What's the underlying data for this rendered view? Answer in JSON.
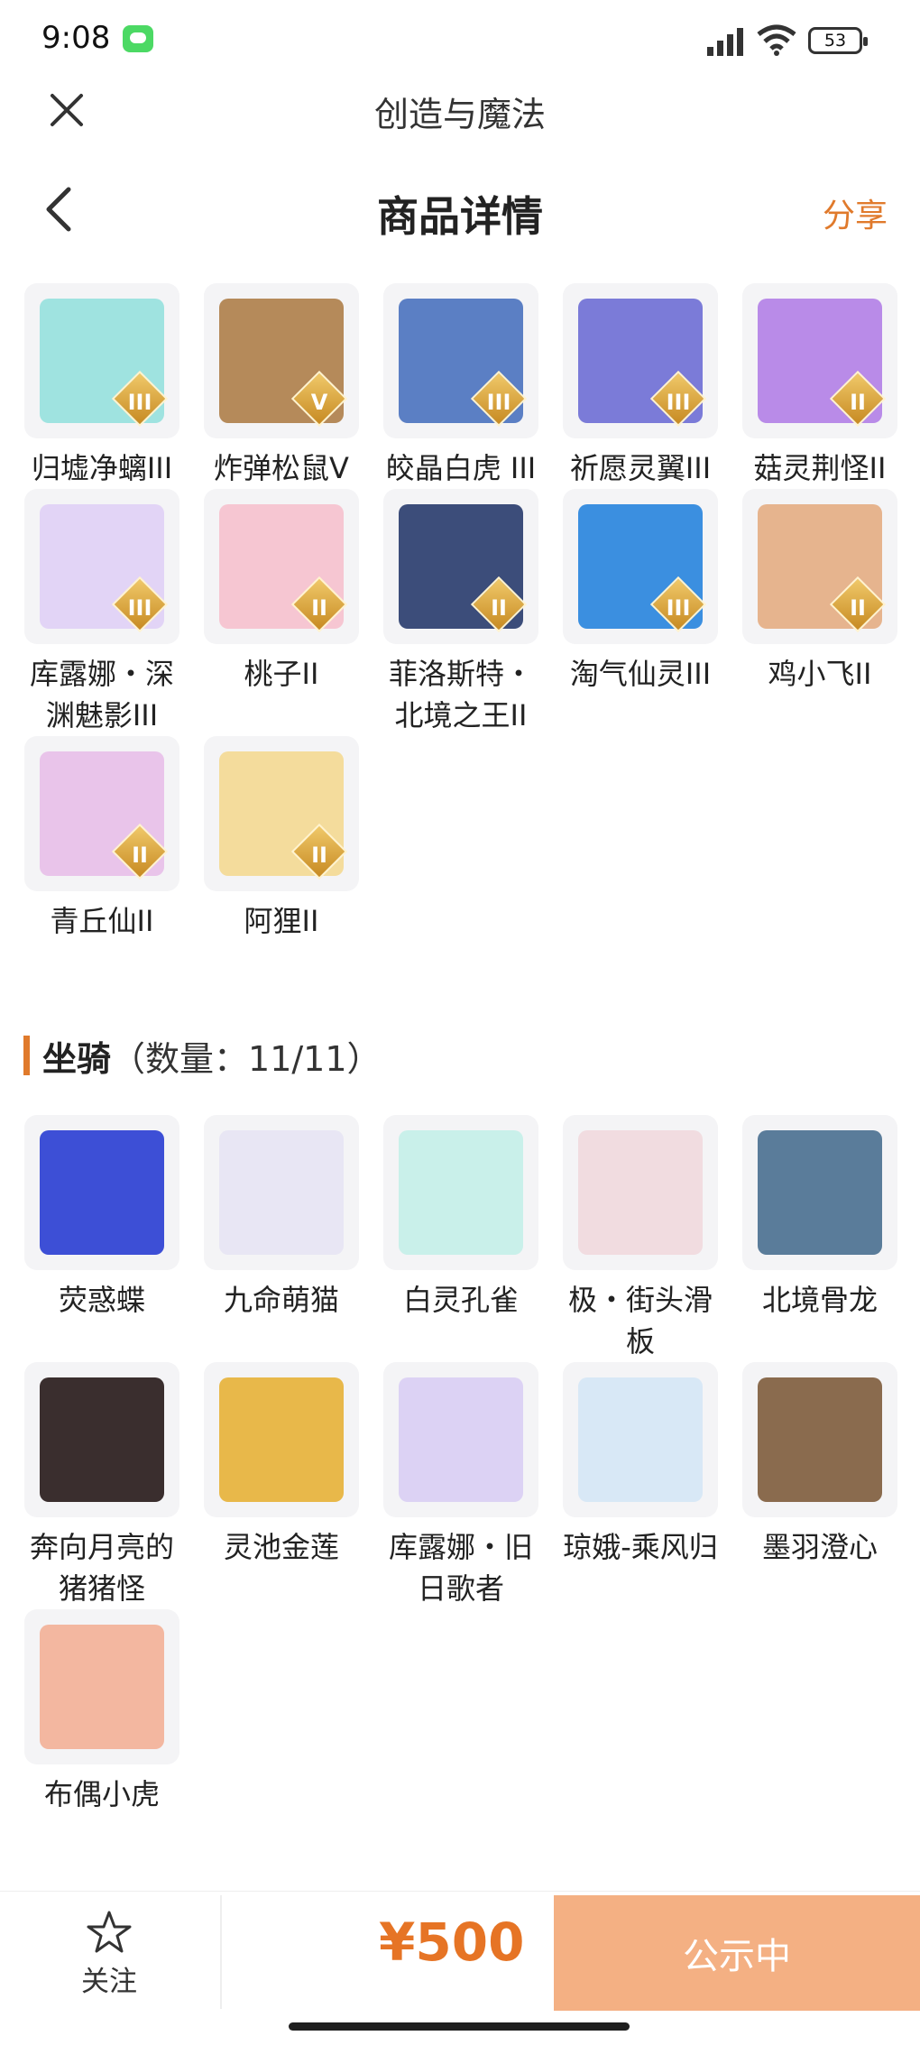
{
  "status": {
    "time": "9:08",
    "battery": "53"
  },
  "app": {
    "title": "创造与魔法"
  },
  "header": {
    "title": "商品详情",
    "share": "分享"
  },
  "pets": [
    {
      "name": "归墟净螭III",
      "rank": "III",
      "color": "#9fe3e0"
    },
    {
      "name": "炸弹松鼠Ⅴ",
      "rank": "V",
      "color": "#b58a5a"
    },
    {
      "name": "皎晶白虎 III",
      "rank": "III",
      "color": "#5b7fc4"
    },
    {
      "name": "祈愿灵翼III",
      "rank": "III",
      "color": "#7b7bd8"
    },
    {
      "name": "菇灵荆怪II",
      "rank": "II",
      "color": "#b98be8"
    },
    {
      "name": "库露娜・深渊魅影III",
      "rank": "III",
      "color": "#e2d4f6"
    },
    {
      "name": "桃子II",
      "rank": "II",
      "color": "#f6c6d2"
    },
    {
      "name": "菲洛斯特・北境之王II",
      "rank": "II",
      "color": "#3c4d7a"
    },
    {
      "name": "淘气仙灵III",
      "rank": "III",
      "color": "#3b8fe0"
    },
    {
      "name": "鸡小飞II",
      "rank": "II",
      "color": "#e6b48e"
    },
    {
      "name": "青丘仙II",
      "rank": "II",
      "color": "#e9c4ea"
    },
    {
      "name": "阿狸II",
      "rank": "II",
      "color": "#f4dc9c"
    }
  ],
  "mounts_section": {
    "title": "坐骑",
    "count": "（数量：11/11）"
  },
  "mounts": [
    {
      "name": "荧惑蝶",
      "color": "#3d4fd6"
    },
    {
      "name": "九命萌猫",
      "color": "#e8e6f4"
    },
    {
      "name": "白灵孔雀",
      "color": "#c9f0ea"
    },
    {
      "name": "极・街头滑板",
      "color": "#f1dce0"
    },
    {
      "name": "北境骨龙",
      "color": "#5a7c9a"
    },
    {
      "name": "奔向月亮的猪猪怪",
      "color": "#3a2e2e"
    },
    {
      "name": "灵池金莲",
      "color": "#e8b84a"
    },
    {
      "name": "库露娜・旧日歌者",
      "color": "#dcd2f4"
    },
    {
      "name": "琼娥-乘风归",
      "color": "#d8e8f6"
    },
    {
      "name": "墨羽澄心",
      "color": "#8a6b4e"
    },
    {
      "name": "布偶小虎",
      "color": "#f3b7a0"
    }
  ],
  "bottom": {
    "follow": "关注",
    "price": "¥500",
    "status_button": "公示中"
  },
  "colors": {
    "accent": "#e07a2c",
    "button_bg": "#f4b083"
  }
}
